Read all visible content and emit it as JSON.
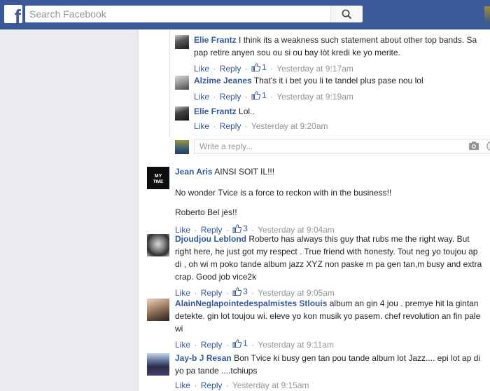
{
  "header": {
    "logo_letter": "f",
    "search_placeholder": "Search Facebook"
  },
  "actions_labels": {
    "like": "Like",
    "reply": "Reply",
    "separator": "·"
  },
  "replies": [
    {
      "name": "Elie Frantz",
      "text": "I think its a weakness such statement about other top bands. Sa pap retire anyen sou ou si ou bay lòt kredi ke yo merite.",
      "likes": "1",
      "time": "Yesterday at 9:17am"
    },
    {
      "name": "Alzime Jeanes",
      "text": "That's it i bet you li te tandel plus pase nou lol",
      "likes": "1",
      "time": "Yesterday at 9:19am"
    },
    {
      "name": "Elie Frantz",
      "text": "Lol..",
      "likes": "",
      "time": "Yesterday at 9:20am"
    }
  ],
  "reply_box": {
    "placeholder": "Write a reply..."
  },
  "comments": [
    {
      "name": "Jean Aris",
      "text": "AINSI SOIT IL!!!",
      "text2": "No wonder Tvice is a force to reckon with in the business!!",
      "text3": "Roberto Bel jès!!",
      "likes": "3",
      "time": "Yesterday at 9:04am",
      "avatar_label": "MY TIME"
    },
    {
      "name": "Djoudjou Leblond",
      "text": "Roberto has always this guy that rubs me the right way. But right here, he just got my respect . True friend with honesty. Tout neg yo toujou ap di , oh wi m poko tande album jazz XYZ non paske m pa gen tan,m busy and extra crap. Good job vice2k",
      "likes": "3",
      "time": "Yesterday at 9:05am"
    },
    {
      "name": "AlainNeglapointedespalmistes Stlouis",
      "text": "album an gin 4 jou . premye hit la gintan detekte. gin lot toujou wi. eleve yo kon musik yo pasem. chef revolution an fin pale wi",
      "likes": "1",
      "time": "Yesterday at 9:11am"
    },
    {
      "name": "Jay-b J Resan",
      "text": "Bon Tvice ki busy gen tan pou tande album lot Jazz.... epi lot ap di yo pa tande ....tchiups",
      "likes": "",
      "time": "Yesterday at 9:15am"
    }
  ],
  "colors": {
    "brand_blue": "#3b5998",
    "link_blue": "#365899",
    "meta_gray": "#90949c"
  }
}
